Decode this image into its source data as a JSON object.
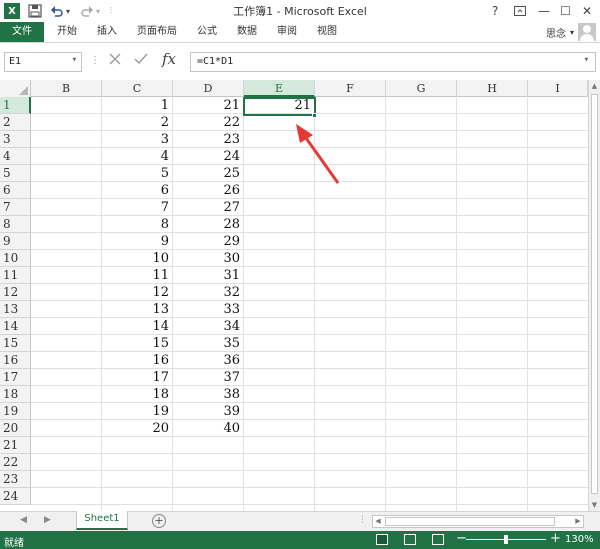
{
  "window": {
    "title": "工作簿1 - Microsoft Excel",
    "logo": "X",
    "help_label": "?",
    "minimize_label": "—",
    "restore_label": "☐",
    "close_label": "✕"
  },
  "ribbon": {
    "file_tab": "文件",
    "tabs": [
      "开始",
      "插入",
      "页面布局",
      "公式",
      "数据",
      "审阅",
      "视图"
    ],
    "user_name": "思念"
  },
  "formula_bar": {
    "name_box": "E1",
    "formula": "=C1*D1",
    "fx_label": "fx"
  },
  "grid": {
    "columns": [
      "B",
      "C",
      "D",
      "E",
      "F",
      "G",
      "H",
      "I"
    ],
    "selected_column": "E",
    "rows": [
      "1",
      "2",
      "3",
      "4",
      "5",
      "6",
      "7",
      "8",
      "9",
      "10",
      "11",
      "12",
      "13",
      "14",
      "15",
      "16",
      "17",
      "18",
      "19",
      "20",
      "21",
      "22",
      "23",
      "24"
    ],
    "selected_row": "1",
    "column_C": [
      "1",
      "2",
      "3",
      "4",
      "5",
      "6",
      "7",
      "8",
      "9",
      "10",
      "11",
      "12",
      "13",
      "14",
      "15",
      "16",
      "17",
      "18",
      "19",
      "20"
    ],
    "column_D": [
      "21",
      "22",
      "23",
      "24",
      "25",
      "26",
      "27",
      "28",
      "29",
      "30",
      "31",
      "32",
      "33",
      "34",
      "35",
      "36",
      "37",
      "38",
      "39",
      "40"
    ],
    "E1": "21"
  },
  "annotation": {
    "arrow_color": "#e53935"
  },
  "sheets": {
    "tabs": [
      "Sheet1"
    ],
    "add_label": "+"
  },
  "status": {
    "text": "就绪",
    "zoom": "130%",
    "zoom_minus": "−",
    "zoom_plus": "+"
  },
  "colors": {
    "brand": "#217346",
    "header_bg": "#f3f3f3",
    "selected_header_bg": "#d3e9dc"
  }
}
